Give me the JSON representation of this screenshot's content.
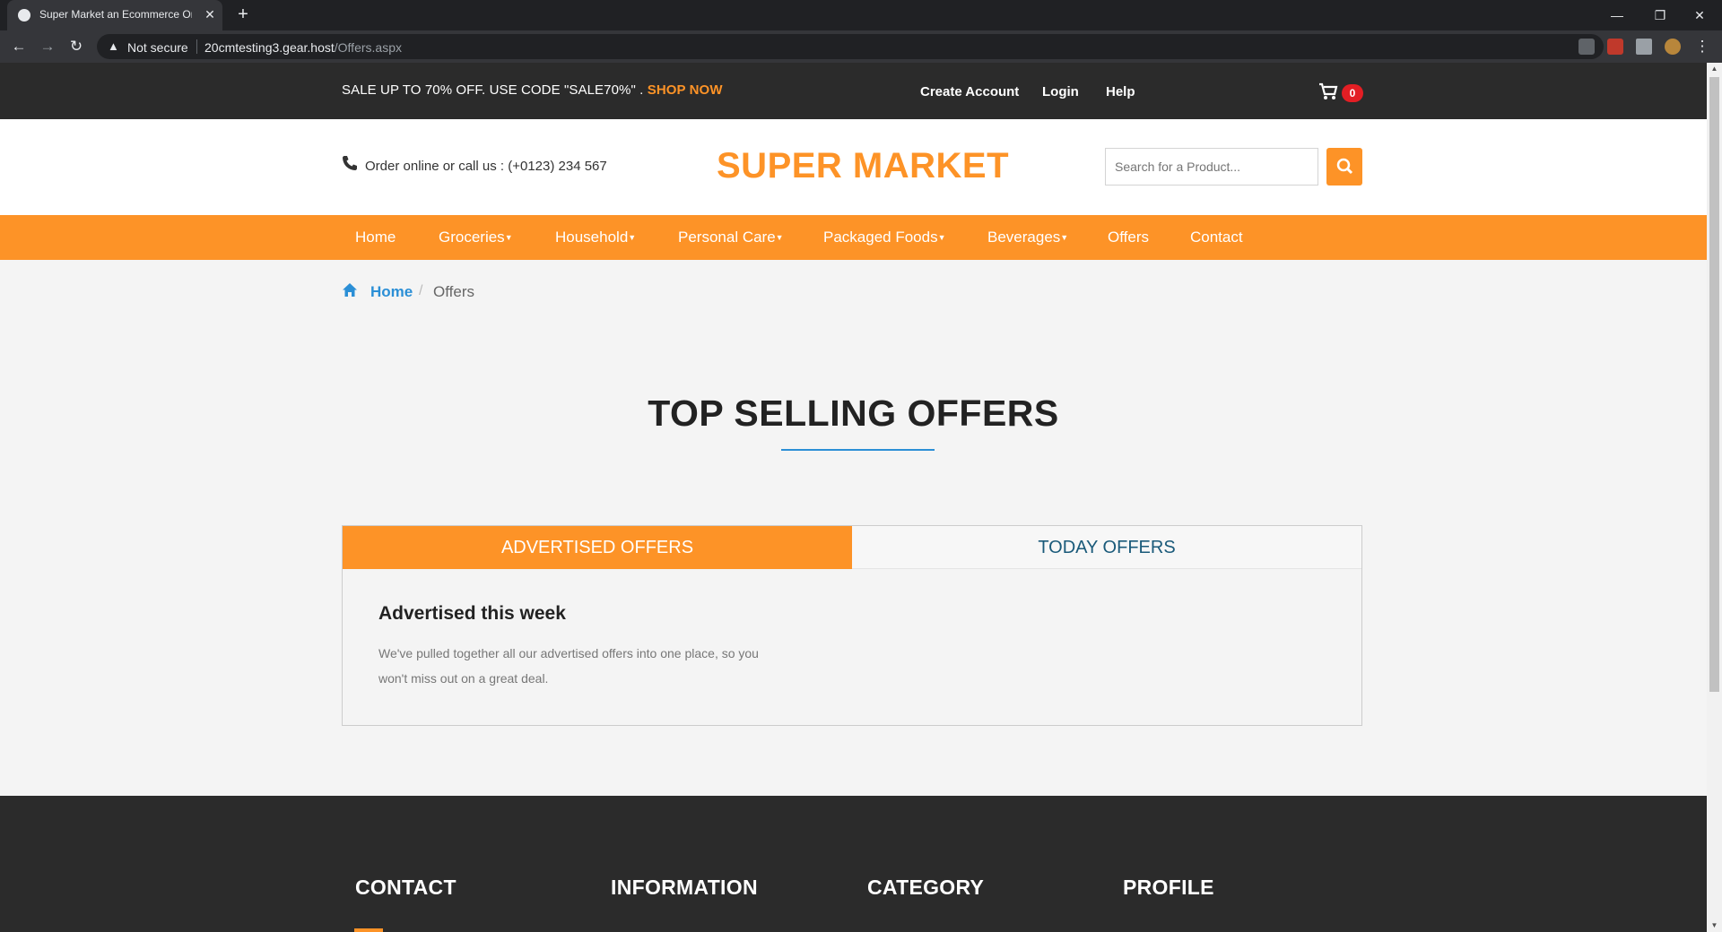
{
  "browser": {
    "tab_title": "Super Market an Ecommerce Online",
    "new_tab_label": "+",
    "security_label": "Not secure",
    "url_host": "20cmtesting3.gear.host",
    "url_path": "/Offers.aspx"
  },
  "topbar": {
    "promo_text": "SALE UP TO 70% OFF. USE CODE \"SALE70%\" . ",
    "promo_link": "SHOP NOW",
    "links": [
      "Create Account",
      "Login",
      "Help"
    ],
    "cart_count": "0"
  },
  "header": {
    "call_text": "Order online or call us : (+0123) 234 567",
    "logo": "SUPER MARKET",
    "search_placeholder": "Search for a Product..."
  },
  "nav": {
    "items": [
      {
        "label": "Home",
        "caret": ""
      },
      {
        "label": "Groceries",
        "caret": "▼"
      },
      {
        "label": "Household",
        "caret": "▼"
      },
      {
        "label": "Personal Care",
        "caret": "▼"
      },
      {
        "label": "Packaged Foods",
        "caret": "▼"
      },
      {
        "label": "Beverages",
        "caret": "▼"
      },
      {
        "label": "Offers",
        "caret": ""
      },
      {
        "label": "Contact",
        "caret": ""
      }
    ]
  },
  "breadcrumb": {
    "home": "Home",
    "separator": "/",
    "current": "Offers"
  },
  "main": {
    "title": "TOP SELLING OFFERS",
    "tabs": [
      "ADVERTISED OFFERS",
      "TODAY OFFERS"
    ],
    "active_tab": "ADVERTISED OFFERS",
    "panel_title": "Advertised this week",
    "panel_text": "We've pulled together all our advertised offers into one place, so you won't miss out on a great deal."
  },
  "footer": {
    "headings": [
      "CONTACT",
      "INFORMATION",
      "CATEGORY",
      "PROFILE"
    ]
  },
  "colors": {
    "accent": "#fd9327",
    "dark": "#2b2b2b",
    "link_blue": "#2b8fd6",
    "badge_red": "#e31e24"
  },
  "icons": [
    "globe-icon",
    "close-icon",
    "back-icon",
    "forward-icon",
    "reload-icon",
    "warning-icon",
    "star-icon",
    "puzzle-icon",
    "cart-icon",
    "phone-icon",
    "search-icon",
    "home-icon"
  ]
}
